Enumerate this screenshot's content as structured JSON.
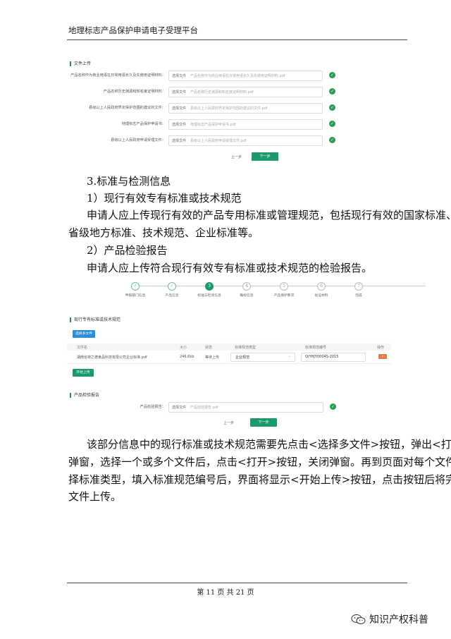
{
  "header": {
    "title": "地理标志产品保护申请电子受理平台"
  },
  "upload_section": {
    "title": "文件上传",
    "choose_label": "选择文件",
    "rows": [
      {
        "label": "产品名称作为商业用语在日常用语长久及先使用证明材料：",
        "file": "产品名称作为商业用语在日常用语长久及先使用证明材料.pdf"
      },
      {
        "label": "产品名称历史渊源和知名度证明材料：",
        "file": "产品名称历史渊源和知名度证明材料.pdf"
      },
      {
        "label": "县级以上人民政府界定保护范围的建议的文件：",
        "file": "县级以上人民政府界定保护范围的建议的文件.pdf"
      },
      {
        "label": "地理标志产品保护申请书：",
        "file": "地理标志产品保护申请书.pdf"
      },
      {
        "label": "县级以上人民政府申请受理文件：",
        "file": "县级以上人民政府申请受理文件.pdf"
      }
    ],
    "prev": "上一步",
    "next": "下一步"
  },
  "body_text": {
    "h3": "3.标准与检测信息",
    "p1": "1）现行有效专有标准或技术规范",
    "p2a": "申请人应上传现行有效的产品专用标准或管理规范，包括现行有效的国家标准、",
    "p2b": "省级地方标准、技术规范、企业标准等。",
    "p3": "2）产品检验报告",
    "p4": "申请人应上传符合现行有效专有标准或技术规范的检验报告。"
  },
  "steps": [
    {
      "num": "✓",
      "label": "申报部门信息",
      "state": "done"
    },
    {
      "num": "✓",
      "label": "产品信息",
      "state": "done"
    },
    {
      "num": "3",
      "label": "标准与检测信息",
      "state": "active"
    },
    {
      "num": "4",
      "label": "确标信息",
      "state": "todo"
    },
    {
      "num": "5",
      "label": "产品保护要求",
      "state": "todo"
    },
    {
      "num": "6",
      "label": "佐证材料",
      "state": "todo"
    },
    {
      "num": "7",
      "label": "完成",
      "state": "todo"
    }
  ],
  "standards_section": {
    "title": "现行专有标准或技术规范",
    "choose_multi": "选择多文件",
    "columns": [
      "文件名",
      "大小",
      "状态",
      "标准规范类型",
      "标准规范编号",
      "操作"
    ],
    "row": {
      "file": "湖南省荷之德食品科技有限公司企业标准.pdf",
      "size": "246.6kb",
      "status": "等待上传",
      "type": "企业规范",
      "code": "Q/YHJY0004S-2015"
    },
    "start_upload": "开始上传"
  },
  "inspection_section": {
    "title": "产品检验报告",
    "label": "产品检验报告：",
    "choose_label": "选择文件",
    "file": "产品检验报告.pdf",
    "prev": "上一步",
    "next": "下一步"
  },
  "description": {
    "l1": "该部分信息中的现行标准或技术规范需要先点击<选择多文件>按钮，弹出<打开>",
    "l2": "弹窗，选择一个或多个文件后，点击<打开>按钮，关闭弹窗。再到页面对每个文件选",
    "l3": "择标准类型，填入标准规范编号后，界面将显示<开始上传>按钮，点击按钮后将完成",
    "l4": "文件上传。"
  },
  "footer": {
    "page": "第 11 页 共 21 页"
  },
  "watermark": {
    "text": "知识产权科普"
  }
}
